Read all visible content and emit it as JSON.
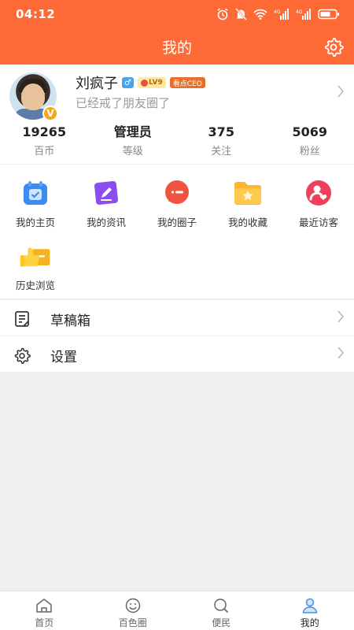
{
  "status_bar": {
    "time": "04:12"
  },
  "header": {
    "title": "我的"
  },
  "profile": {
    "name": "刘疯子",
    "gender_symbol": "♂",
    "level": "LV9",
    "role_badge": "看点CEO",
    "signature": "已经戒了朋友圈了",
    "avatar_badge": "V"
  },
  "stats": [
    {
      "value": "19265",
      "label": "百币"
    },
    {
      "value": "管理员",
      "label": "等级"
    },
    {
      "value": "375",
      "label": "关注"
    },
    {
      "value": "5069",
      "label": "粉丝"
    }
  ],
  "grid": [
    {
      "label": "我的主页",
      "icon": "homepage-icon"
    },
    {
      "label": "我的资讯",
      "icon": "news-edit-icon"
    },
    {
      "label": "我的圈子",
      "icon": "circle-chat-icon"
    },
    {
      "label": "我的收藏",
      "icon": "favorite-folder-icon"
    },
    {
      "label": "最近访客",
      "icon": "visitor-icon"
    },
    {
      "label": "历史浏览",
      "icon": "history-thumb-icon"
    }
  ],
  "list": [
    {
      "label": "草稿箱",
      "icon": "drafts-icon"
    },
    {
      "label": "设置",
      "icon": "gear-icon"
    }
  ],
  "tabs": [
    {
      "label": "首页",
      "icon": "home-icon"
    },
    {
      "label": "百色圈",
      "icon": "smile-icon"
    },
    {
      "label": "便民",
      "icon": "search-icon"
    },
    {
      "label": "我的",
      "icon": "user-icon"
    }
  ],
  "colors": {
    "accent": "#fe6a36",
    "background": "#f0f0f0"
  }
}
